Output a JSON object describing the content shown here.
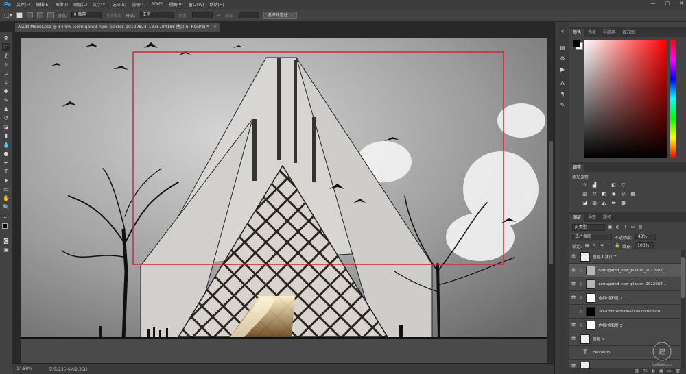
{
  "app": {
    "logo": "Ps",
    "window_controls": [
      "—",
      "▢",
      "✕"
    ]
  },
  "menu": {
    "items": [
      "文件(F)",
      "编辑(E)",
      "图像(I)",
      "图层(L)",
      "文字(Y)",
      "选择(S)",
      "滤镜(T)",
      "3D(D)",
      "视图(V)",
      "窗口(W)",
      "帮助(H)"
    ]
  },
  "options": {
    "feather_label": "羽化:",
    "feather_value": "0 像素",
    "antialias_label": "消除锯齿",
    "style_label": "样式:",
    "style_value": "正常",
    "width_label": "宽度:",
    "height_label": "高度:",
    "select_mask_button": "选择并遮住 ..."
  },
  "document": {
    "tab_title": "A立面-Model.psd @ 14.9% (corrugated_new_plaster_20120824_1375704186 拷贝 6, RGB/8) *",
    "close": "×"
  },
  "status": {
    "zoom": "14.89%",
    "doc_size": "文档:235.6M/2.35G"
  },
  "panels": {
    "color_tabs": [
      "颜色",
      "色板",
      "导航器",
      "直方图"
    ],
    "adjust_tabs": [
      "调整"
    ],
    "add_adjust_label": "添加调整",
    "layers_tabs": [
      "图层",
      "通道",
      "路径"
    ],
    "kind_label": "ρ 类型",
    "blend_mode": "正片叠底",
    "opacity_label": "不透明度:",
    "opacity_value": "43%",
    "lock_label": "锁定:",
    "fill_label": "填充:",
    "fill_value": "100%",
    "layers": [
      {
        "name": "图层 1 拷贝 7",
        "thumb": "checker",
        "selected": false,
        "eye": true,
        "linked": false
      },
      {
        "name": "corrugated_new_plaster_2012082...",
        "thumb": "plaster",
        "selected": true,
        "eye": true,
        "linked": true
      },
      {
        "name": "corrugated_new_plaster_2012082...",
        "thumb": "plaster",
        "selected": false,
        "eye": true,
        "linked": true
      },
      {
        "name": "色相/饱和度 2",
        "thumb": "white",
        "selected": false,
        "eye": true,
        "linked": true
      },
      {
        "name": "3D-architectural-visualization-du...",
        "thumb": "black",
        "selected": false,
        "eye": false,
        "linked": true
      },
      {
        "name": "色相/饱和度 3",
        "thumb": "white",
        "selected": false,
        "eye": true,
        "linked": true
      },
      {
        "name": "图层 8",
        "thumb": "checker",
        "selected": false,
        "eye": true,
        "linked": false
      },
      {
        "name": "Elevation",
        "thumb": "text",
        "selected": false,
        "eye": false,
        "linked": false
      },
      {
        "name": "",
        "thumb": "checker",
        "selected": false,
        "eye": true,
        "linked": false
      }
    ],
    "bottom_icons": [
      "fx",
      "◐",
      "▣",
      "▭",
      "🗑"
    ]
  },
  "watermark": {
    "text": "building.cn"
  },
  "colors": {
    "accent": "#31a8ff",
    "selection": "#e0202a"
  }
}
